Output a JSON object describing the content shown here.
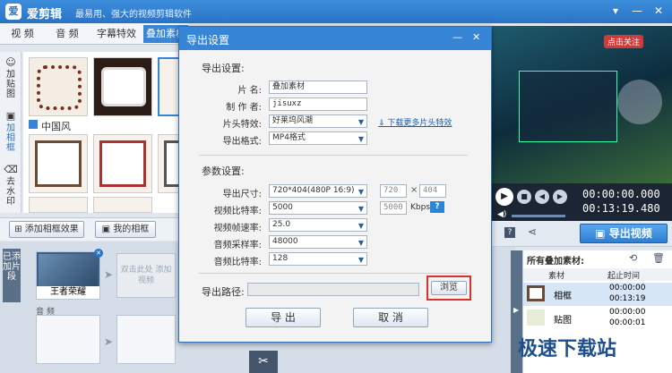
{
  "app": {
    "title": "爱剪辑",
    "slogan": "最易用、强大的视频剪辑软件",
    "logo_char": "爱"
  },
  "window_controls": {
    "menu": "▾",
    "minimize": "—",
    "close": "✕"
  },
  "tabs": [
    {
      "label": "视 频"
    },
    {
      "label": "音 频"
    },
    {
      "label": "字幕特效"
    },
    {
      "label": "叠加素材"
    }
  ],
  "left_nav": {
    "stickers": "加贴图",
    "frames": "加相框",
    "watermark": "去水印"
  },
  "content": {
    "section_label": "中国风"
  },
  "bottom_bar": {
    "add_frame_effect": "添加相框效果",
    "my_frames": "我的相框"
  },
  "timeline": {
    "added_clips_label": "已添加片段",
    "clip_label": "王者荣耀",
    "add_video_hint": "双击此处 添加视频",
    "audio_label": "音 频"
  },
  "dialog": {
    "title": "导出设置",
    "section_export": "导出设置:",
    "film_name_label": "片    名:",
    "film_name_value": "叠加素材",
    "author_label": "制 作 者:",
    "author_value": "jisuxz",
    "intro_label": "片头特效:",
    "intro_value": "好莱坞风潮",
    "download_link": "下载更多片头特效",
    "format_label": "导出格式:",
    "format_value": "MP4格式",
    "section_params": "参数设置:",
    "size_label": "导出尺寸:",
    "size_value": "720*404(480P 16:9)",
    "width_value": "720",
    "size_sep": "×",
    "height_value": "404",
    "vbitrate_label": "视频比特率:",
    "vbitrate_value": "5000",
    "vbitrate_custom": "5000",
    "vbitrate_unit": "Kbps",
    "help": "?",
    "framerate_label": "视频帧速率:",
    "framerate_value": "25.0",
    "samplerate_label": "音频采样率:",
    "samplerate_value": "48000",
    "abitrate_label": "音频比特率:",
    "abitrate_value": "128",
    "path_label": "导出路径:",
    "path_value": "",
    "browse_button": "浏览",
    "export_button": "导 出",
    "cancel_button": "取 消"
  },
  "preview": {
    "overlay_text": "点击关注"
  },
  "player": {
    "current_time": "00:00:00.000",
    "total_time": "00:13:19.480"
  },
  "export_video_button": "导出视频",
  "materials": {
    "title": "所有叠加素材:",
    "col_material": "素材",
    "col_time": "起止时间",
    "rows": [
      {
        "name": "相框",
        "start": "00:00:00",
        "end": "00:13:19"
      },
      {
        "name": "贴图",
        "start": "00:00:00",
        "end": "00:00:01"
      }
    ]
  },
  "watermark_text": "极速下载站",
  "colors": {
    "accent": "#3685d6",
    "highlight_border": "#d9322c"
  }
}
